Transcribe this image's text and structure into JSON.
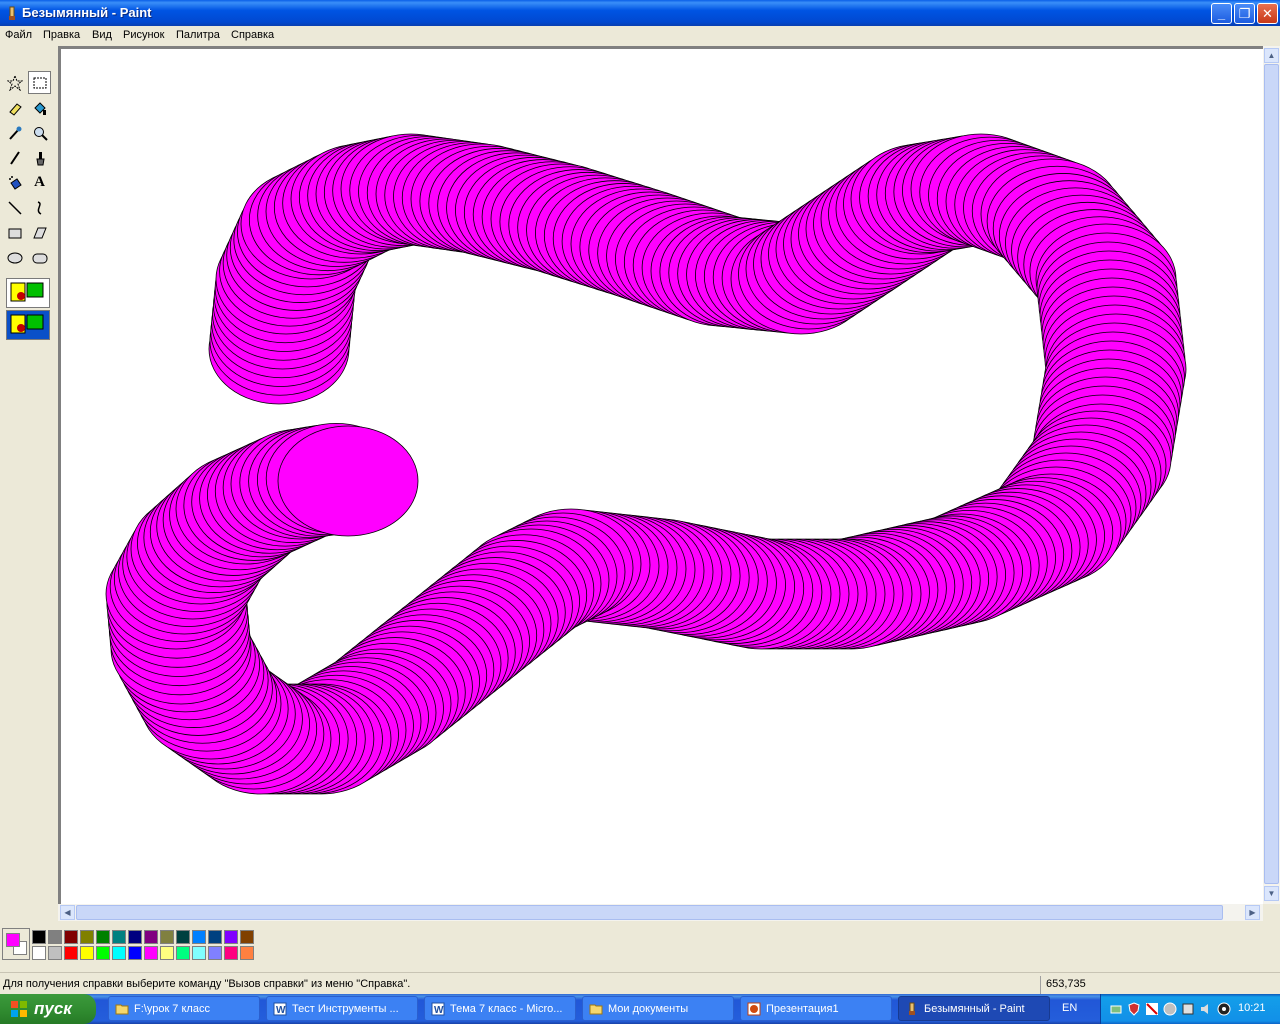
{
  "window": {
    "title": "Безымянный - Paint"
  },
  "menu": [
    "Файл",
    "Правка",
    "Вид",
    "Рисунок",
    "Палитра",
    "Справка"
  ],
  "toolbox": {
    "tools": [
      {
        "name": "free-select",
        "selected": false
      },
      {
        "name": "rect-select",
        "selected": true
      },
      {
        "name": "eraser",
        "selected": false
      },
      {
        "name": "fill",
        "selected": false
      },
      {
        "name": "color-picker",
        "selected": false
      },
      {
        "name": "magnifier",
        "selected": false
      },
      {
        "name": "pencil",
        "selected": false
      },
      {
        "name": "brush",
        "selected": false
      },
      {
        "name": "airbrush",
        "selected": false
      },
      {
        "name": "text",
        "selected": false
      },
      {
        "name": "line",
        "selected": false
      },
      {
        "name": "curve",
        "selected": false
      },
      {
        "name": "rectangle",
        "selected": false
      },
      {
        "name": "polygon",
        "selected": false
      },
      {
        "name": "ellipse",
        "selected": false
      },
      {
        "name": "rounded-rectangle",
        "selected": false
      }
    ],
    "text_glyph": "A"
  },
  "palette": {
    "primary": "#ff00ff",
    "secondary": "#ffffff",
    "colors_top": [
      "#000000",
      "#808080",
      "#800000",
      "#808000",
      "#008000",
      "#008080",
      "#000080",
      "#800080",
      "#808040",
      "#004040",
      "#0080ff",
      "#004080",
      "#8000ff",
      "#804000"
    ],
    "colors_bottom": [
      "#ffffff",
      "#c0c0c0",
      "#ff0000",
      "#ffff00",
      "#00ff00",
      "#00ffff",
      "#0000ff",
      "#ff00ff",
      "#ffff80",
      "#00ff80",
      "#80ffff",
      "#8080ff",
      "#ff0080",
      "#ff8040"
    ]
  },
  "drawing": {
    "fill": "#ff00ff",
    "stroke": "#000000"
  },
  "status": {
    "help": "Для получения справки выберите команду \"Вызов справки\" из меню \"Справка\".",
    "coords": "653,735"
  },
  "taskbar": {
    "start": "пуск",
    "tasks": [
      {
        "label": "F:\\урок 7 класс",
        "icon": "folder-icon",
        "active": false
      },
      {
        "label": "Тест  Инструменты ...",
        "icon": "word-icon",
        "active": false
      },
      {
        "label": "Тема 7 класс - Micro...",
        "icon": "word-icon",
        "active": false
      },
      {
        "label": "Мои документы",
        "icon": "folder-icon",
        "active": false
      },
      {
        "label": "Презентация1",
        "icon": "powerpoint-icon",
        "active": false
      },
      {
        "label": "Безымянный - Paint",
        "icon": "paint-icon",
        "active": true
      }
    ],
    "lang": "EN",
    "clock": "10:21"
  }
}
